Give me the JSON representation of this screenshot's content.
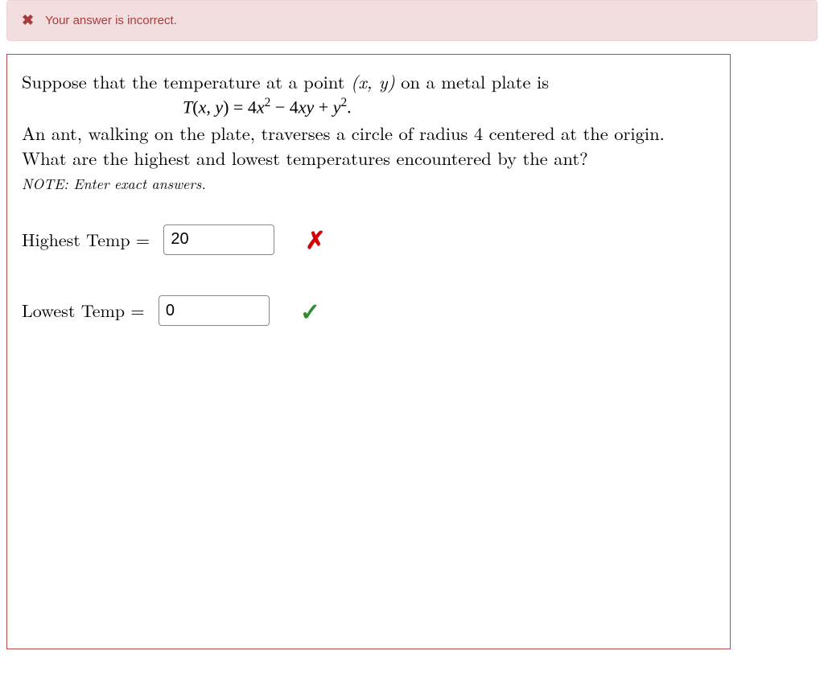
{
  "alert": {
    "message": "Your answer is incorrect."
  },
  "question": {
    "line1_pre": "Suppose that the temperature at a point ",
    "line1_post": " on a metal plate is",
    "formula_prefix": "T",
    "formula_args_open": "(",
    "formula_x": "x",
    "formula_comma": ", ",
    "formula_y": "y",
    "formula_args_close": ") = 4",
    "formula_x2": "x",
    "formula_mid1": " − 4",
    "formula_xy1": "x",
    "formula_xy2": "y",
    "formula_mid2": " + ",
    "formula_y2": "y",
    "formula_dot": ".",
    "line2": "An ant, walking on the plate, traverses a circle of radius 4 centered at the origin.",
    "line3": "What are the highest and lowest temperatures encountered by the ant?",
    "note": "NOTE: Enter exact answers."
  },
  "answers": {
    "highest": {
      "label": "Highest Temp = ",
      "value": "20",
      "correct": false
    },
    "lowest": {
      "label": "Lowest Temp = ",
      "value": "0",
      "correct": true
    }
  }
}
